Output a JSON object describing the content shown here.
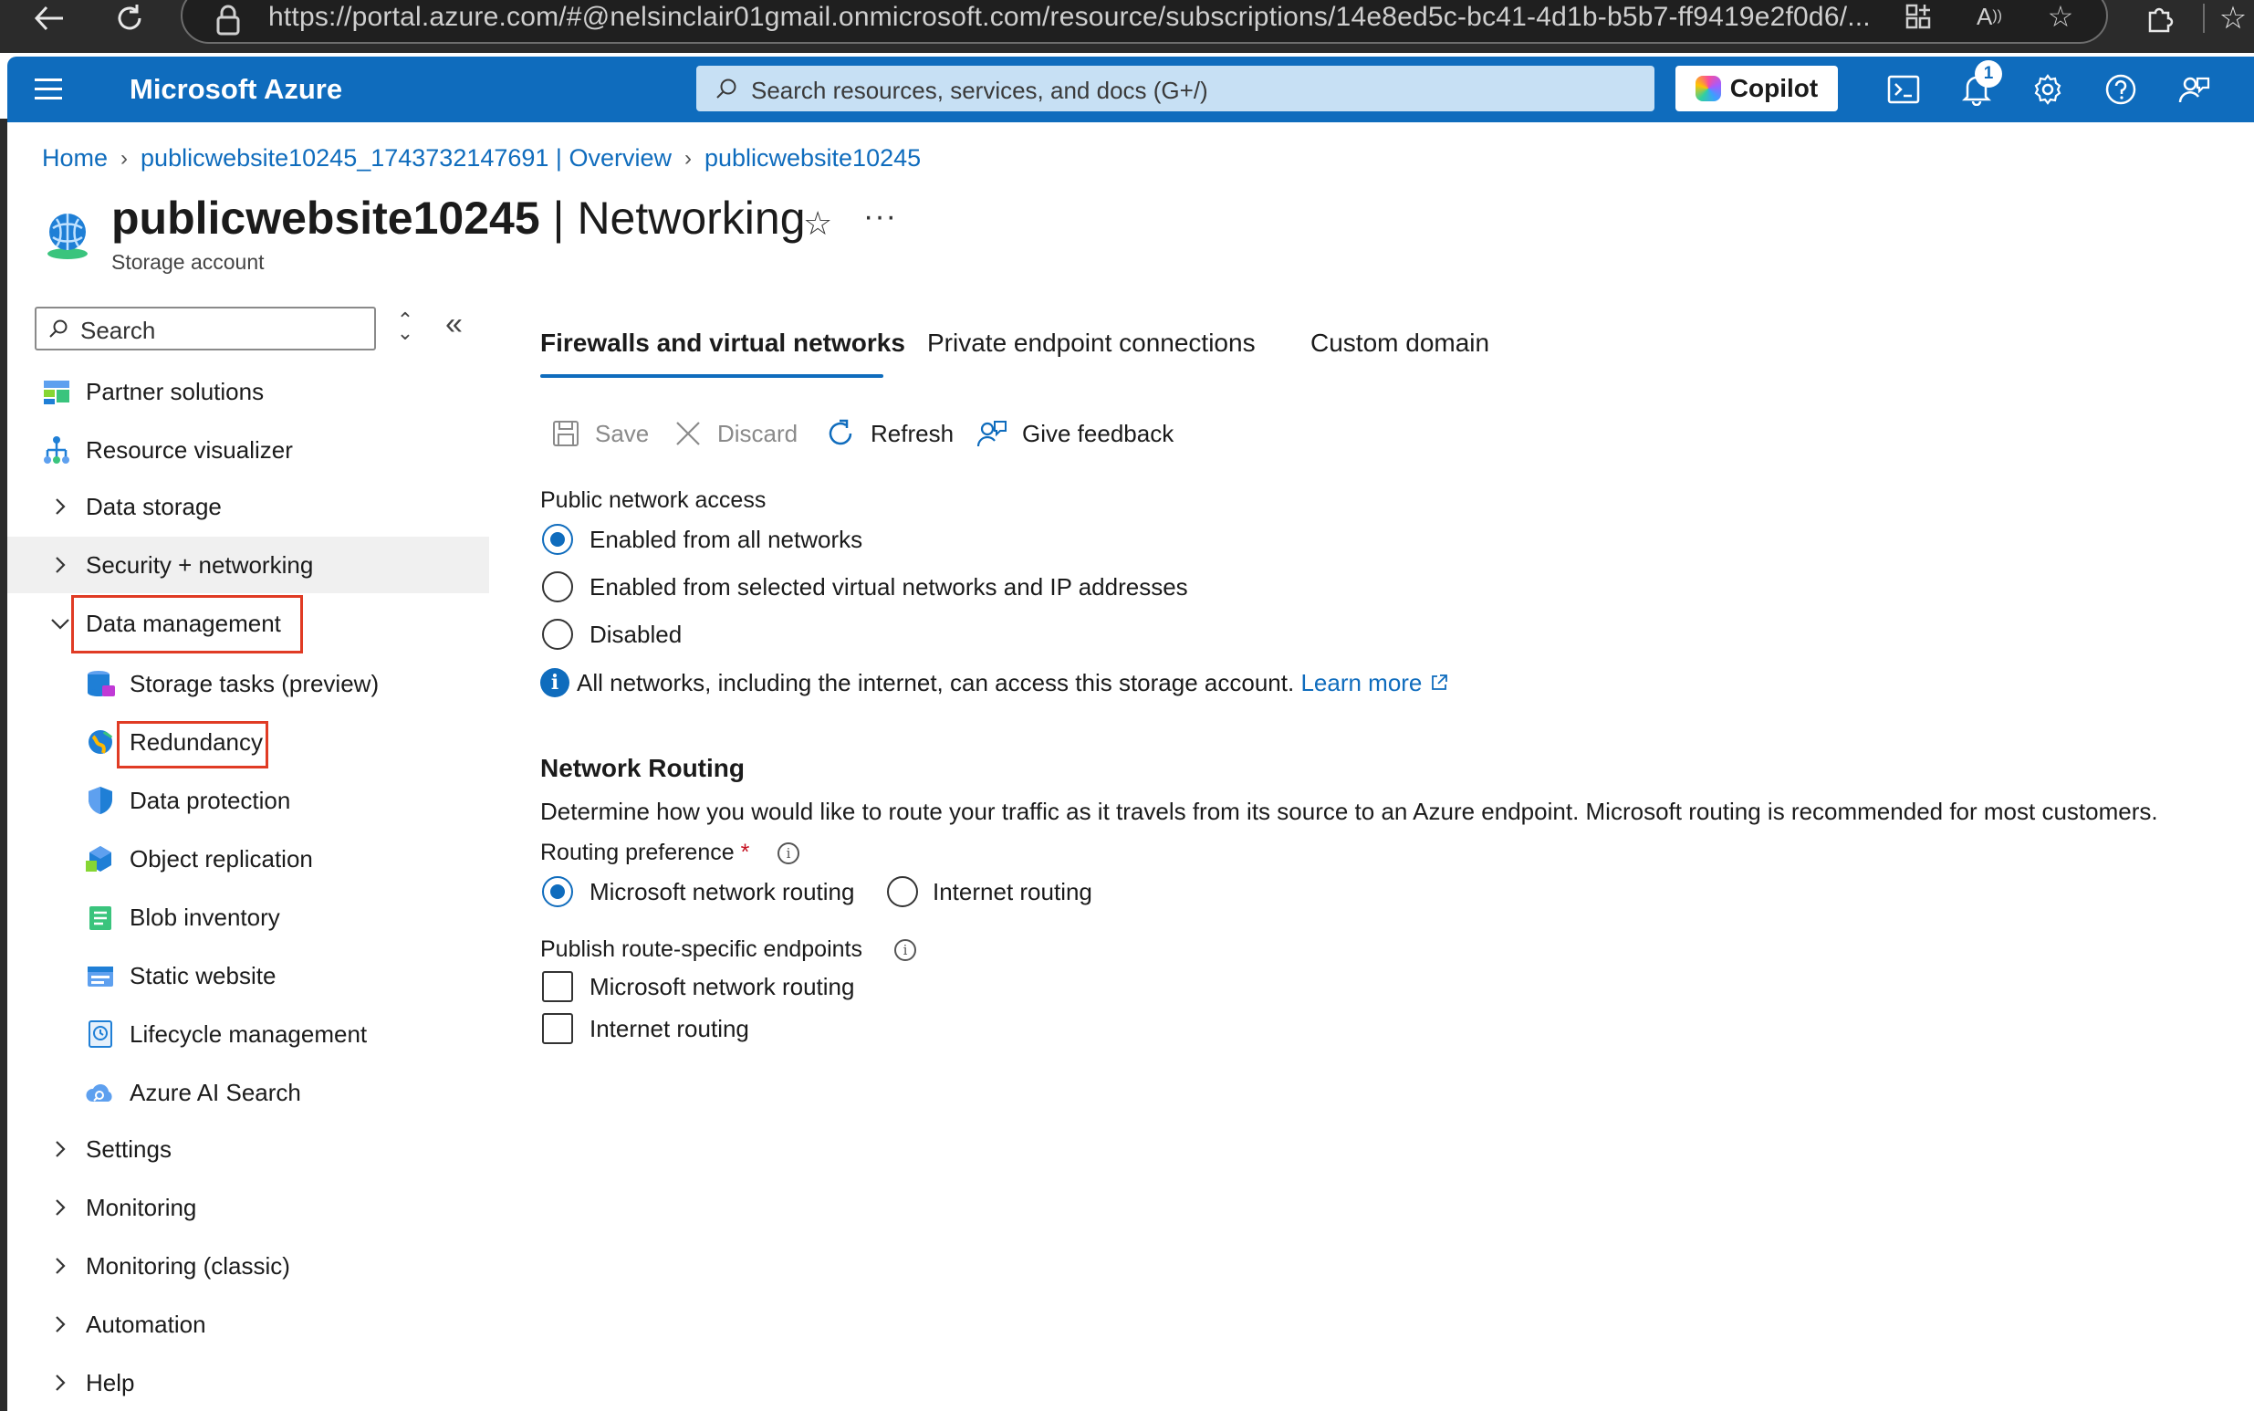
{
  "browser": {
    "url": "https://portal.azure.com/#@nelsinclair01gmail.onmicrosoft.com/resource/subscriptions/14e8ed5c-bc41-4d1b-b5b7-ff9419e2f0d6/..."
  },
  "header": {
    "brand": "Microsoft Azure",
    "search_placeholder": "Search resources, services, and docs (G+/)",
    "copilot_label": "Copilot",
    "notification_count": "1"
  },
  "breadcrumb": [
    "Home",
    "publicwebsite10245_1743732147691 | Overview",
    "publicwebsite10245"
  ],
  "title": {
    "resource": "publicwebsite10245",
    "separator": " | ",
    "blade": "Networking",
    "subtitle": "Storage account"
  },
  "sidebar": {
    "search_placeholder": "Search",
    "items": [
      {
        "label": "Partner solutions"
      },
      {
        "label": "Resource visualizer"
      },
      {
        "label": "Data storage"
      },
      {
        "label": "Security + networking"
      },
      {
        "label": "Data management"
      },
      {
        "label": "Storage tasks (preview)"
      },
      {
        "label": "Redundancy"
      },
      {
        "label": "Data protection"
      },
      {
        "label": "Object replication"
      },
      {
        "label": "Blob inventory"
      },
      {
        "label": "Static website"
      },
      {
        "label": "Lifecycle management"
      },
      {
        "label": "Azure AI Search"
      },
      {
        "label": "Settings"
      },
      {
        "label": "Monitoring"
      },
      {
        "label": "Monitoring (classic)"
      },
      {
        "label": "Automation"
      },
      {
        "label": "Help"
      }
    ]
  },
  "tabs": [
    {
      "label": "Firewalls and virtual networks",
      "selected": true
    },
    {
      "label": "Private endpoint connections",
      "selected": false
    },
    {
      "label": "Custom domain",
      "selected": false
    }
  ],
  "toolbar": {
    "save": "Save",
    "discard": "Discard",
    "refresh": "Refresh",
    "feedback": "Give feedback"
  },
  "public_access": {
    "label": "Public network access",
    "options": [
      {
        "label": "Enabled from all networks",
        "selected": true
      },
      {
        "label": "Enabled from selected virtual networks and IP addresses",
        "selected": false
      },
      {
        "label": "Disabled",
        "selected": false
      }
    ],
    "info_text": "All networks, including the internet, can access this storage account.",
    "learn_more": "Learn more"
  },
  "routing": {
    "section_title": "Network Routing",
    "description": "Determine how you would like to route your traffic as it travels from its source to an Azure endpoint. Microsoft routing is recommended for most customers.",
    "preference_label": "Routing preference",
    "required_mark": "*",
    "preference_options": [
      {
        "label": "Microsoft network routing",
        "selected": true
      },
      {
        "label": "Internet routing",
        "selected": false
      }
    ],
    "publish_label": "Publish route-specific endpoints",
    "publish_options": [
      {
        "label": "Microsoft network routing",
        "checked": false
      },
      {
        "label": "Internet routing",
        "checked": false
      }
    ]
  },
  "colors": {
    "azure_blue": "#0f6cbd",
    "highlight_red": "#e03b24"
  }
}
